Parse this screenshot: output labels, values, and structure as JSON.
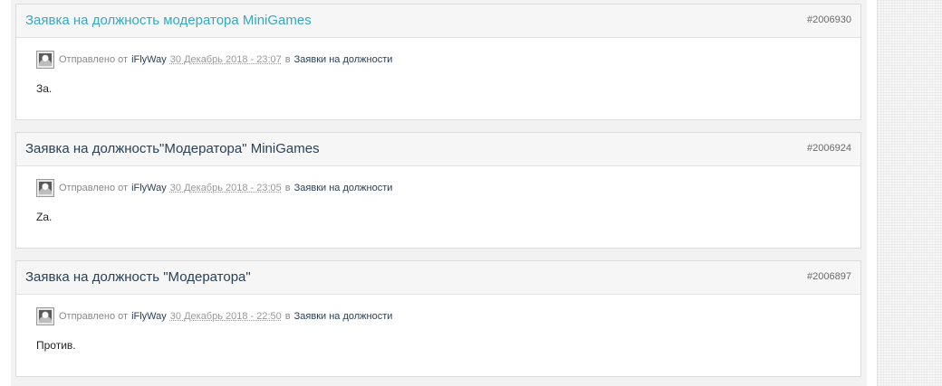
{
  "posts": [
    {
      "title": "Заявка на должность модератора MiniGames",
      "id": "#2006930",
      "sent_label": "Отправлено от",
      "author": "iFlyWay",
      "date": "30 Декабрь 2018 - 23:07",
      "in_label": "в",
      "forum": "Заявки на должности",
      "text": "За."
    },
    {
      "title": "Заявка на должность\"Модератора\" MiniGames",
      "id": "#2006924",
      "sent_label": "Отправлено от",
      "author": "iFlyWay",
      "date": "30 Декабрь 2018 - 23:05",
      "in_label": "в",
      "forum": "Заявки на должности",
      "text": "Za."
    },
    {
      "title": "Заявка на должность \"Модератора\"",
      "id": "#2006897",
      "sent_label": "Отправлено от",
      "author": "iFlyWay",
      "date": "30 Декабрь 2018 - 22:50",
      "in_label": "в",
      "forum": "Заявки на должности",
      "text": "Против."
    }
  ]
}
